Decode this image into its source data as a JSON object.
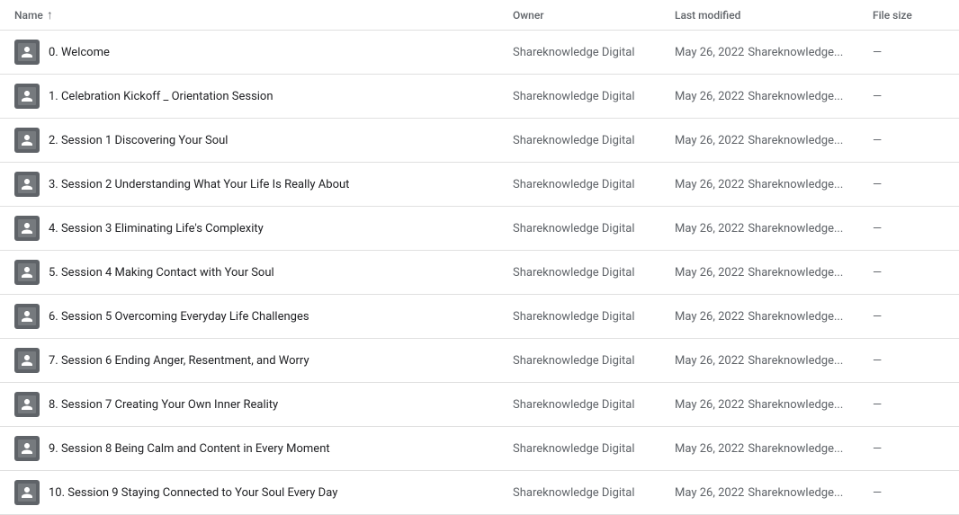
{
  "header": {
    "col_name": "Name",
    "col_owner": "Owner",
    "col_modified": "Last modified",
    "col_size": "File size",
    "sort_arrow": "↑"
  },
  "rows": [
    {
      "id": 0,
      "label": "0. Welcome",
      "owner": "Shareknowledge Digital",
      "modified_date": "May 26, 2022",
      "modified_user": "Shareknowledge...",
      "size": "—"
    },
    {
      "id": 1,
      "label": "1. Celebration Kickoff _ Orientation Session",
      "owner": "Shareknowledge Digital",
      "modified_date": "May 26, 2022",
      "modified_user": "Shareknowledge...",
      "size": "—"
    },
    {
      "id": 2,
      "label": "2. Session 1 Discovering Your Soul",
      "owner": "Shareknowledge Digital",
      "modified_date": "May 26, 2022",
      "modified_user": "Shareknowledge...",
      "size": "—"
    },
    {
      "id": 3,
      "label": "3. Session 2 Understanding What Your Life Is Really About",
      "owner": "Shareknowledge Digital",
      "modified_date": "May 26, 2022",
      "modified_user": "Shareknowledge...",
      "size": "—"
    },
    {
      "id": 4,
      "label": "4. Session 3 Eliminating Life's Complexity",
      "owner": "Shareknowledge Digital",
      "modified_date": "May 26, 2022",
      "modified_user": "Shareknowledge...",
      "size": "—"
    },
    {
      "id": 5,
      "label": "5. Session 4 Making Contact with Your Soul",
      "owner": "Shareknowledge Digital",
      "modified_date": "May 26, 2022",
      "modified_user": "Shareknowledge...",
      "size": "—"
    },
    {
      "id": 6,
      "label": "6. Session 5 Overcoming Everyday Life Challenges",
      "owner": "Shareknowledge Digital",
      "modified_date": "May 26, 2022",
      "modified_user": "Shareknowledge...",
      "size": "—"
    },
    {
      "id": 7,
      "label": "7. Session 6 Ending Anger, Resentment, and Worry",
      "owner": "Shareknowledge Digital",
      "modified_date": "May 26, 2022",
      "modified_user": "Shareknowledge...",
      "size": "—"
    },
    {
      "id": 8,
      "label": "8. Session 7 Creating Your Own Inner Reality",
      "owner": "Shareknowledge Digital",
      "modified_date": "May 26, 2022",
      "modified_user": "Shareknowledge...",
      "size": "—"
    },
    {
      "id": 9,
      "label": "9. Session 8 Being Calm and Content in Every Moment",
      "owner": "Shareknowledge Digital",
      "modified_date": "May 26, 2022",
      "modified_user": "Shareknowledge...",
      "size": "—"
    },
    {
      "id": 10,
      "label": "10. Session 9 Staying Connected to Your Soul Every Day",
      "owner": "Shareknowledge Digital",
      "modified_date": "May 26, 2022",
      "modified_user": "Shareknowledge...",
      "size": "—"
    }
  ]
}
